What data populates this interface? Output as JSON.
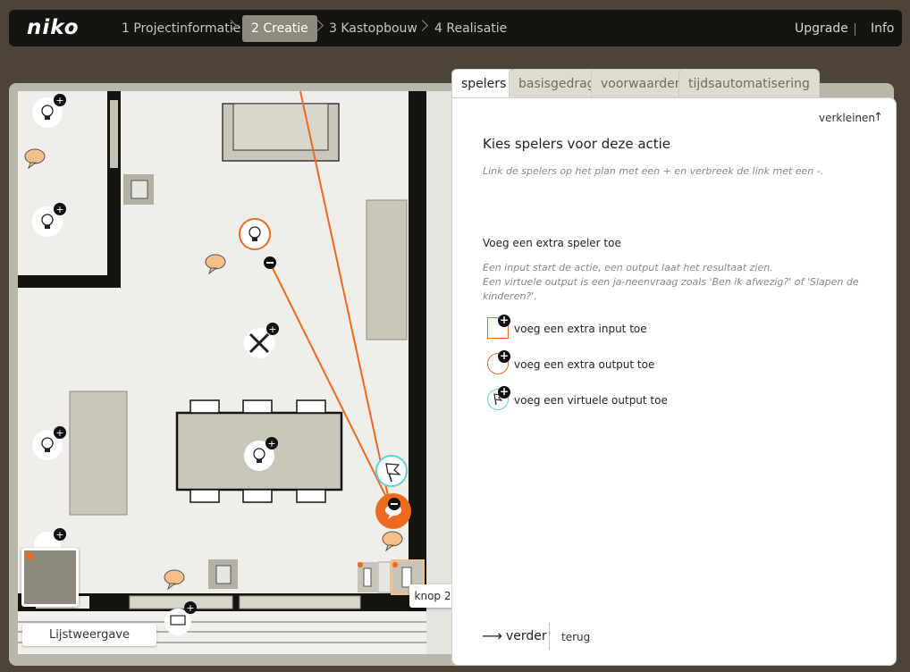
{
  "brand": {
    "logo": "niko"
  },
  "nav": {
    "steps": [
      {
        "label": "1 Projectinformatie"
      },
      {
        "label": "2 Creatie"
      },
      {
        "label": "3 Kastopbouw"
      },
      {
        "label": "4 Realisatie"
      }
    ],
    "upgrade": "Upgrade",
    "info": "Info"
  },
  "tabs": [
    {
      "label": "spelers"
    },
    {
      "label": "basisgedrag"
    },
    {
      "label": "voorwaarden"
    },
    {
      "label": "tijdsautomatisering"
    }
  ],
  "panel": {
    "collapse": "verkleinen",
    "title": "Kies spelers voor deze actie",
    "hint": "Link de spelers op het plan met een + en verbreek de link met een -.",
    "add_heading": "Voeg een extra speler toe",
    "desc_line1": "Een input start de actie, een output laat het resultaat zien.",
    "desc_line2": "Een virtuele output is een ja-neenvraag zoals 'Ben ik afwezig?' of 'Slapen de",
    "desc_line3": "kinderen?'.",
    "add_input": "voeg een extra input toe",
    "add_output": "voeg een extra output toe",
    "add_virtual": "voeg een virtuele output toe",
    "next": "verder",
    "back": "terug"
  },
  "plan": {
    "list_view": "Lijstweergave",
    "tooltip": "knop 2"
  },
  "colors": {
    "accent": "#ee6a1f",
    "virtual": "#5fd0d8",
    "dark": "#161410"
  }
}
